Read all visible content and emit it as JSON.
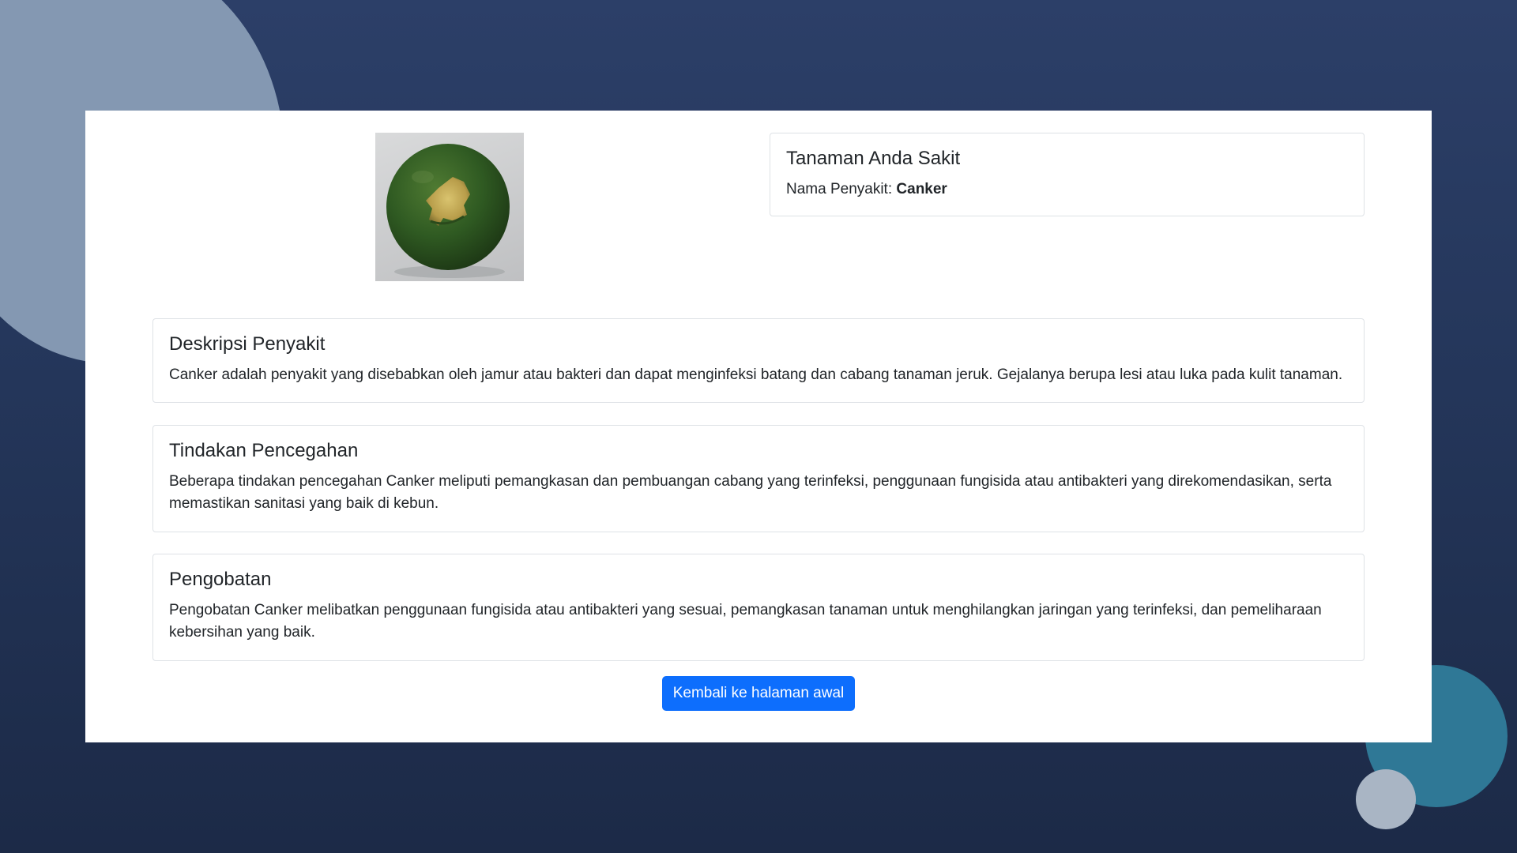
{
  "result": {
    "title": "Tanaman Anda Sakit",
    "disease_label": "Nama Penyakit:",
    "disease_name": "Canker"
  },
  "description": {
    "title": "Deskripsi Penyakit",
    "text": "Canker adalah penyakit yang disebabkan oleh jamur atau bakteri dan dapat menginfeksi batang dan cabang tanaman jeruk. Gejalanya berupa lesi atau luka pada kulit tanaman."
  },
  "prevention": {
    "title": "Tindakan Pencegahan",
    "text": "Beberapa tindakan pencegahan Canker meliputi pemangkasan dan pembuangan cabang yang terinfeksi, penggunaan fungisida atau antibakteri yang direkomendasikan, serta memastikan sanitasi yang baik di kebun."
  },
  "treatment": {
    "title": "Pengobatan",
    "text": "Pengobatan Canker melibatkan penggunaan fungisida atau antibakteri yang sesuai, pemangkasan tanaman untuk menghilangkan jaringan yang terinfeksi, dan pemeliharaan kebersihan yang baik."
  },
  "actions": {
    "back_label": "Kembali ke halaman awal"
  },
  "image": {
    "subject": "green citrus fruit with canker lesion"
  },
  "colors": {
    "primary_button": "#0d6efd",
    "background_dark": "#24365a",
    "card_background": "#ffffff",
    "border": "#dee2e6"
  }
}
